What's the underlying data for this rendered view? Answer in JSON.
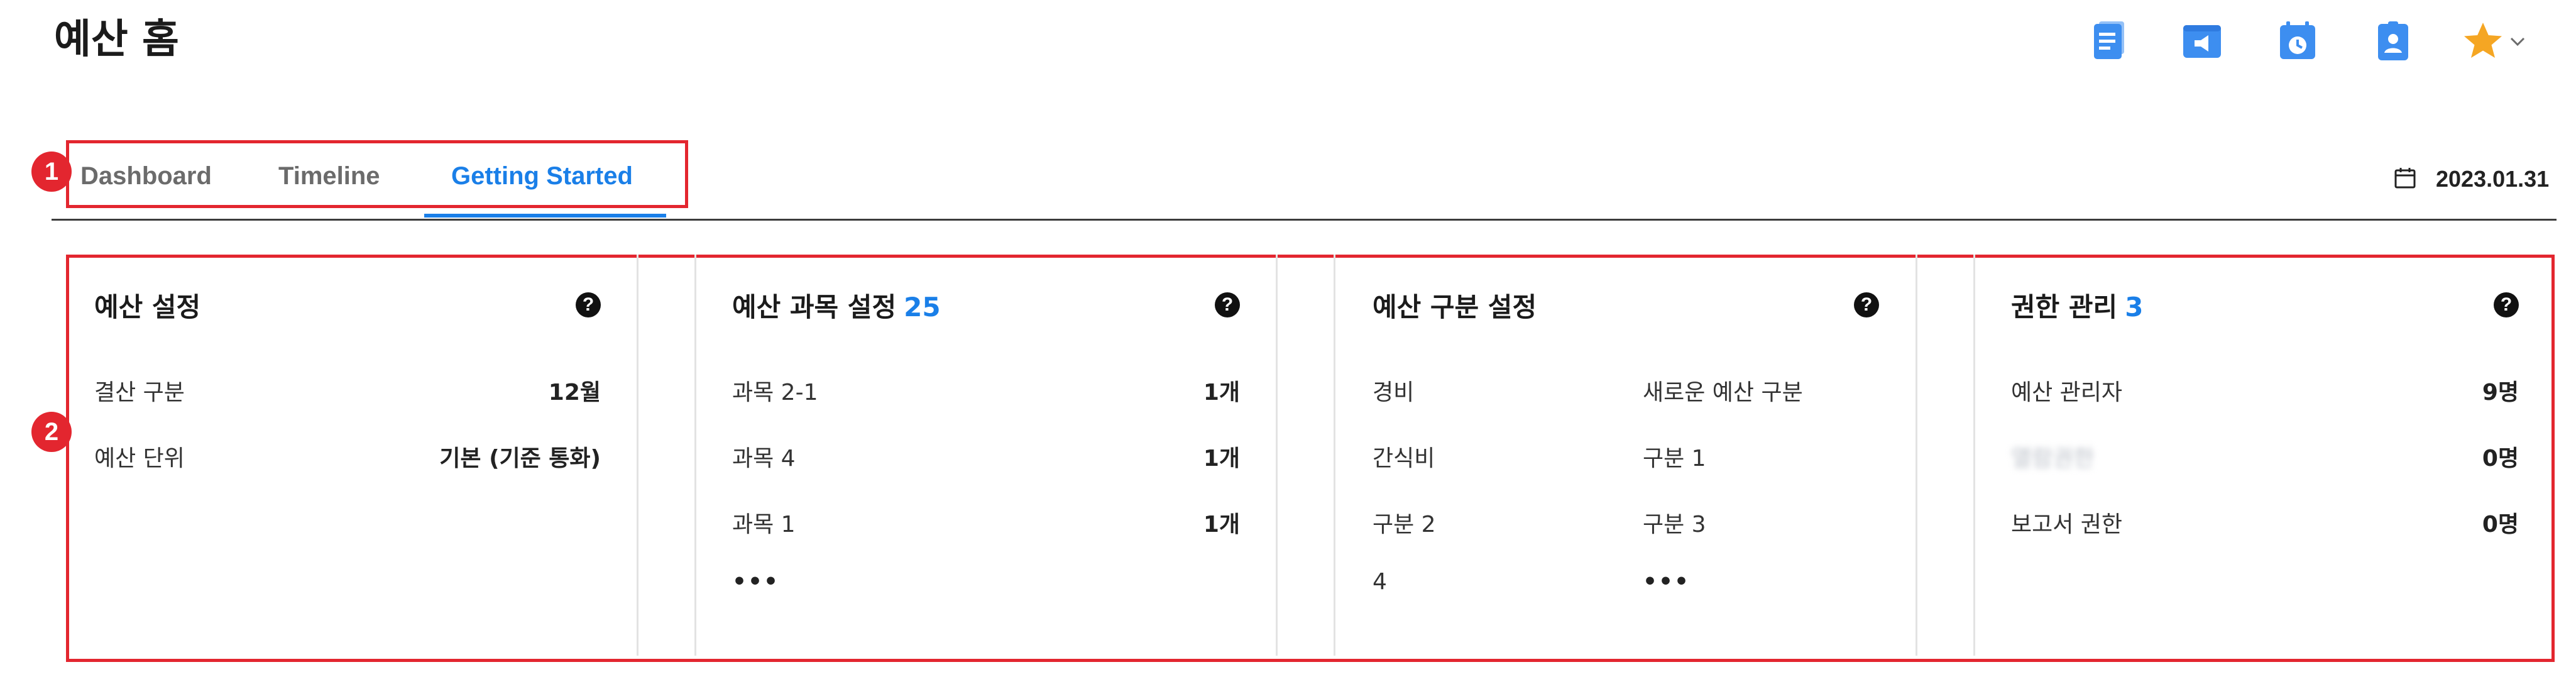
{
  "page": {
    "title": "예산 홈",
    "date": "2023.01.31"
  },
  "toolbar": {
    "icons": [
      "document-icon",
      "announcement-icon",
      "calendar-clock-icon",
      "user-badge-icon",
      "star-icon"
    ],
    "accent": "#3d8ef0",
    "star_color": "#f5a623"
  },
  "tabs": [
    {
      "label": "Dashboard",
      "active": false
    },
    {
      "label": "Timeline",
      "active": false
    },
    {
      "label": "Getting Started",
      "active": true
    }
  ],
  "annotations": [
    {
      "number": "1"
    },
    {
      "number": "2"
    }
  ],
  "cards": {
    "budget_settings": {
      "title": "예산 설정",
      "rows": [
        {
          "label": "결산 구분",
          "value": "12월"
        },
        {
          "label": "예산 단위",
          "value": "기본 (기준 통화)"
        }
      ]
    },
    "budget_subjects": {
      "title": "예산 과목 설정",
      "count": "25",
      "rows": [
        {
          "label": "과목 2-1",
          "value": "1개"
        },
        {
          "label": "과목 4",
          "value": "1개"
        },
        {
          "label": "과목 1",
          "value": "1개"
        }
      ],
      "more": "•••"
    },
    "budget_categories": {
      "title": "예산 구분 설정",
      "col1": [
        "경비",
        "간식비",
        "구분 2",
        "4"
      ],
      "col2": [
        "새로운 예산 구분",
        "구분 1",
        "구분 3",
        "•••"
      ]
    },
    "permissions": {
      "title": "권한 관리",
      "count": "3",
      "rows": [
        {
          "label": "예산 관리자",
          "value": "9명"
        },
        {
          "label": "열람권한",
          "value": "0명",
          "blurred": true
        },
        {
          "label": "보고서 권한",
          "value": "0명"
        }
      ]
    }
  },
  "colors": {
    "active_tab": "#1a7fe8",
    "annotation_red": "#e3262f"
  }
}
